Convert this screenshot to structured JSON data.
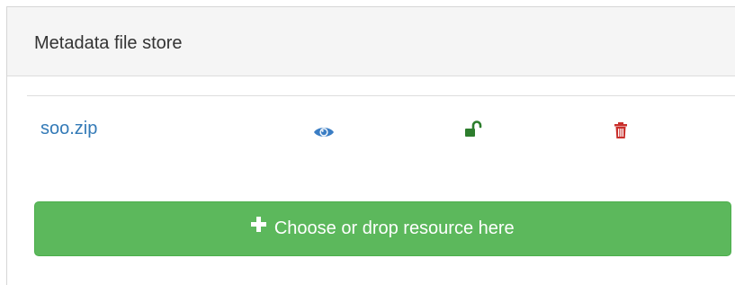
{
  "panel": {
    "title": "Metadata file store"
  },
  "files": [
    {
      "name": "soo.zip",
      "actions": {
        "view_icon": "eye-icon",
        "lock_icon": "unlock-icon",
        "delete_icon": "trash-icon"
      }
    }
  ],
  "upload": {
    "label": "Choose or drop resource here",
    "icon": "plus-icon"
  },
  "colors": {
    "link": "#337ab7",
    "view": "#3a7dc4",
    "lock": "#2d7d2d",
    "delete": "#c9302c",
    "button": "#5cb85c",
    "heading_bg": "#f5f5f5"
  }
}
